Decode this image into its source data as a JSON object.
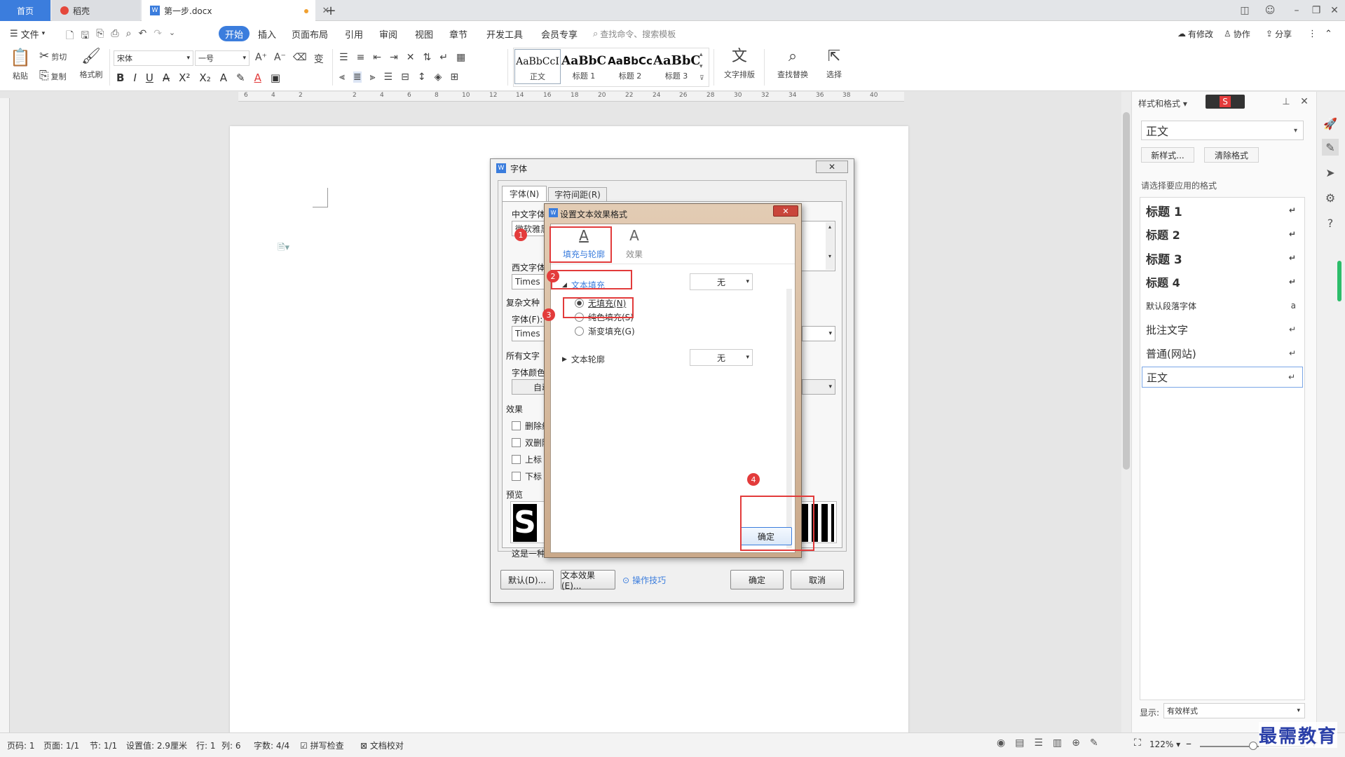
{
  "tabs": {
    "home": "首页",
    "daoke": "稻壳",
    "doc": "第一步.docx"
  },
  "menus": [
    "文件",
    "开始",
    "插入",
    "页面布局",
    "引用",
    "审阅",
    "视图",
    "章节",
    "开发工具",
    "会员专享"
  ],
  "search_placeholder": "查找命令、搜索模板",
  "right_actions": {
    "modify": "有修改",
    "collab": "协作",
    "share": "分享"
  },
  "ribbon": {
    "paste": "粘贴",
    "cut": "剪切",
    "copy": "复制",
    "format_painter": "格式刷",
    "font_name": "宋体",
    "font_size": "一号",
    "styles": [
      {
        "sample": "AaBbCcI",
        "name": "正文"
      },
      {
        "sample": "AaBbC",
        "name": "标题 1"
      },
      {
        "sample": "AaBbCc",
        "name": "标题 2"
      },
      {
        "sample": "AaBbC",
        "name": "标题 3"
      }
    ],
    "text_layout": "文字排版",
    "find_replace": "查找替换",
    "select": "选择"
  },
  "ruler_labels": [
    "6",
    "4",
    "2",
    "",
    "2",
    "4",
    "6",
    "8",
    "10",
    "12",
    "14",
    "16",
    "18",
    "20",
    "22",
    "24",
    "26",
    "28",
    "30",
    "32",
    "34",
    "36",
    "38",
    "40"
  ],
  "pane": {
    "header": "样式和格式",
    "current": "正文",
    "new_style": "新样式...",
    "clear_format": "清除格式",
    "prompt": "请选择要应用的格式",
    "items": [
      "标题 1",
      "标题 2",
      "标题 3",
      "标题 4",
      "默认段落字体",
      "批注文字",
      "普通(网站)",
      "正文"
    ],
    "show_label": "显示:",
    "show_value": "有效样式"
  },
  "font_dialog": {
    "title": "字体",
    "tab_font": "字体(N)",
    "tab_spacing": "字符间距(R)",
    "cn_font_label": "中文字体",
    "cn_font_value": "微软雅黑",
    "west_font_label": "西文字体",
    "west_font_value": "Times",
    "complex_label": "复杂文种",
    "complex_font_label": "字体(F):",
    "complex_font_value": "Times",
    "all_text_label": "所有文字",
    "color_label": "字体颜色",
    "color_value": "自动",
    "effects_label": "效果",
    "effects": [
      "删除线",
      "双删除线",
      "上标",
      "下标"
    ],
    "preview_label": "预览",
    "preview_text": "这是一种",
    "btn_default": "默认(D)...",
    "btn_text_effect": "文本效果(E)...",
    "btn_tips": "操作技巧",
    "btn_ok": "确定",
    "btn_cancel": "取消"
  },
  "effect_dialog": {
    "title": "设置文本效果格式",
    "tab_fill": "填充与轮廓",
    "tab_effect": "效果",
    "section_fill": "文本填充",
    "fill_value": "无",
    "options": [
      "无填充(N)",
      "纯色填充(S)",
      "渐变填充(G)"
    ],
    "section_outline": "文本轮廓",
    "outline_value": "无",
    "ok": "确定"
  },
  "badges": [
    "1",
    "2",
    "3",
    "4"
  ],
  "status": {
    "page": "页码: 1",
    "pages": "页面: 1/1",
    "section": "节: 1/1",
    "setting": "设置值: 2.9厘米",
    "row": "行: 1",
    "col": "列: 6",
    "words": "字数: 4/4",
    "spell": "拼写检查",
    "proof": "文档校对",
    "zoom": "122%"
  },
  "watermark": "最需教育",
  "colors": {
    "accent": "#3b7ddd",
    "highlight": "#e23b3b"
  }
}
